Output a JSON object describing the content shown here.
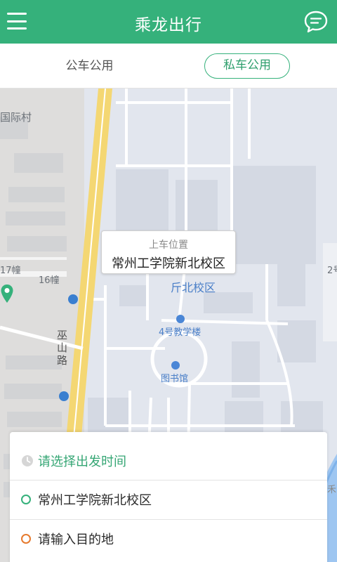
{
  "header": {
    "title": "乘龙出行",
    "menu_icon": "hamburger-menu-icon",
    "message_icon": "chat-bubble-icon"
  },
  "tabs": [
    {
      "label": "公车公用",
      "active": false
    },
    {
      "label": "私车公用",
      "active": true
    }
  ],
  "map": {
    "labels": {
      "village": "国际村",
      "building_17": "17幢",
      "building_16": "16幢",
      "road": "巫山路",
      "teaching_building": "4号教学楼",
      "library": "图书馆",
      "campus_partial": "斤北校区",
      "right_edge": "2号",
      "river_partial": "禾"
    },
    "callout": {
      "label": "上车位置",
      "value": "常州工学院新北校区"
    }
  },
  "panel": {
    "time_prompt": "请选择出发时间",
    "start": "常州工学院新北校区",
    "destination_placeholder": "请输入目的地"
  },
  "colors": {
    "brand": "#35b17b",
    "origin_dot": "#35b17b",
    "destination_dot": "#e67a2e"
  }
}
